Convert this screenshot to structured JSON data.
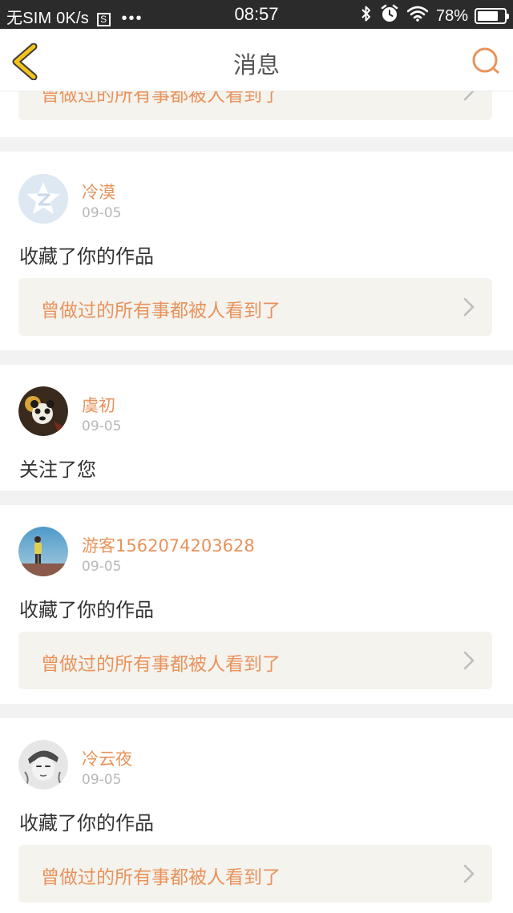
{
  "status_bar": {
    "carrier": "无SIM",
    "speed": "0K/s",
    "s_badge": "S",
    "dots": "•••",
    "time": "08:57",
    "battery_percent": "78%",
    "battery_level": 0.78,
    "icons": [
      "bluetooth-icon",
      "alarm-icon",
      "wifi-icon",
      "battery-icon"
    ]
  },
  "header": {
    "title": "消息",
    "back_icon": "chevron-left-icon",
    "search_icon": "search-icon",
    "accent_back": "#f2c31a",
    "accent_search": "#e8935c"
  },
  "partial_card": {
    "work_title": "曾做过的所有事都被人看到了"
  },
  "messages": [
    {
      "user": "冷漠",
      "date": "09-05",
      "action": "收藏了你的作品",
      "work_title": "曾做过的所有事都被人看到了",
      "avatar": "qzone-star-avatar"
    },
    {
      "user": "虞初",
      "date": "09-05",
      "action": "关注了您",
      "avatar": "panda-avatar"
    },
    {
      "user": "游客1562074203628",
      "date": "09-05",
      "action": "收藏了你的作品",
      "work_title": "曾做过的所有事都被人看到了",
      "avatar": "girl-sky-avatar"
    },
    {
      "user": "冷云夜",
      "date": "09-05",
      "action": "收藏了你的作品",
      "work_title": "曾做过的所有事都被人看到了",
      "avatar": "sketch-face-avatar"
    }
  ],
  "colors": {
    "accent": "#e8935c",
    "date_gray": "#b8b8b8",
    "link_bg": "#f4f3ee",
    "page_bg": "#f2f2f2"
  }
}
